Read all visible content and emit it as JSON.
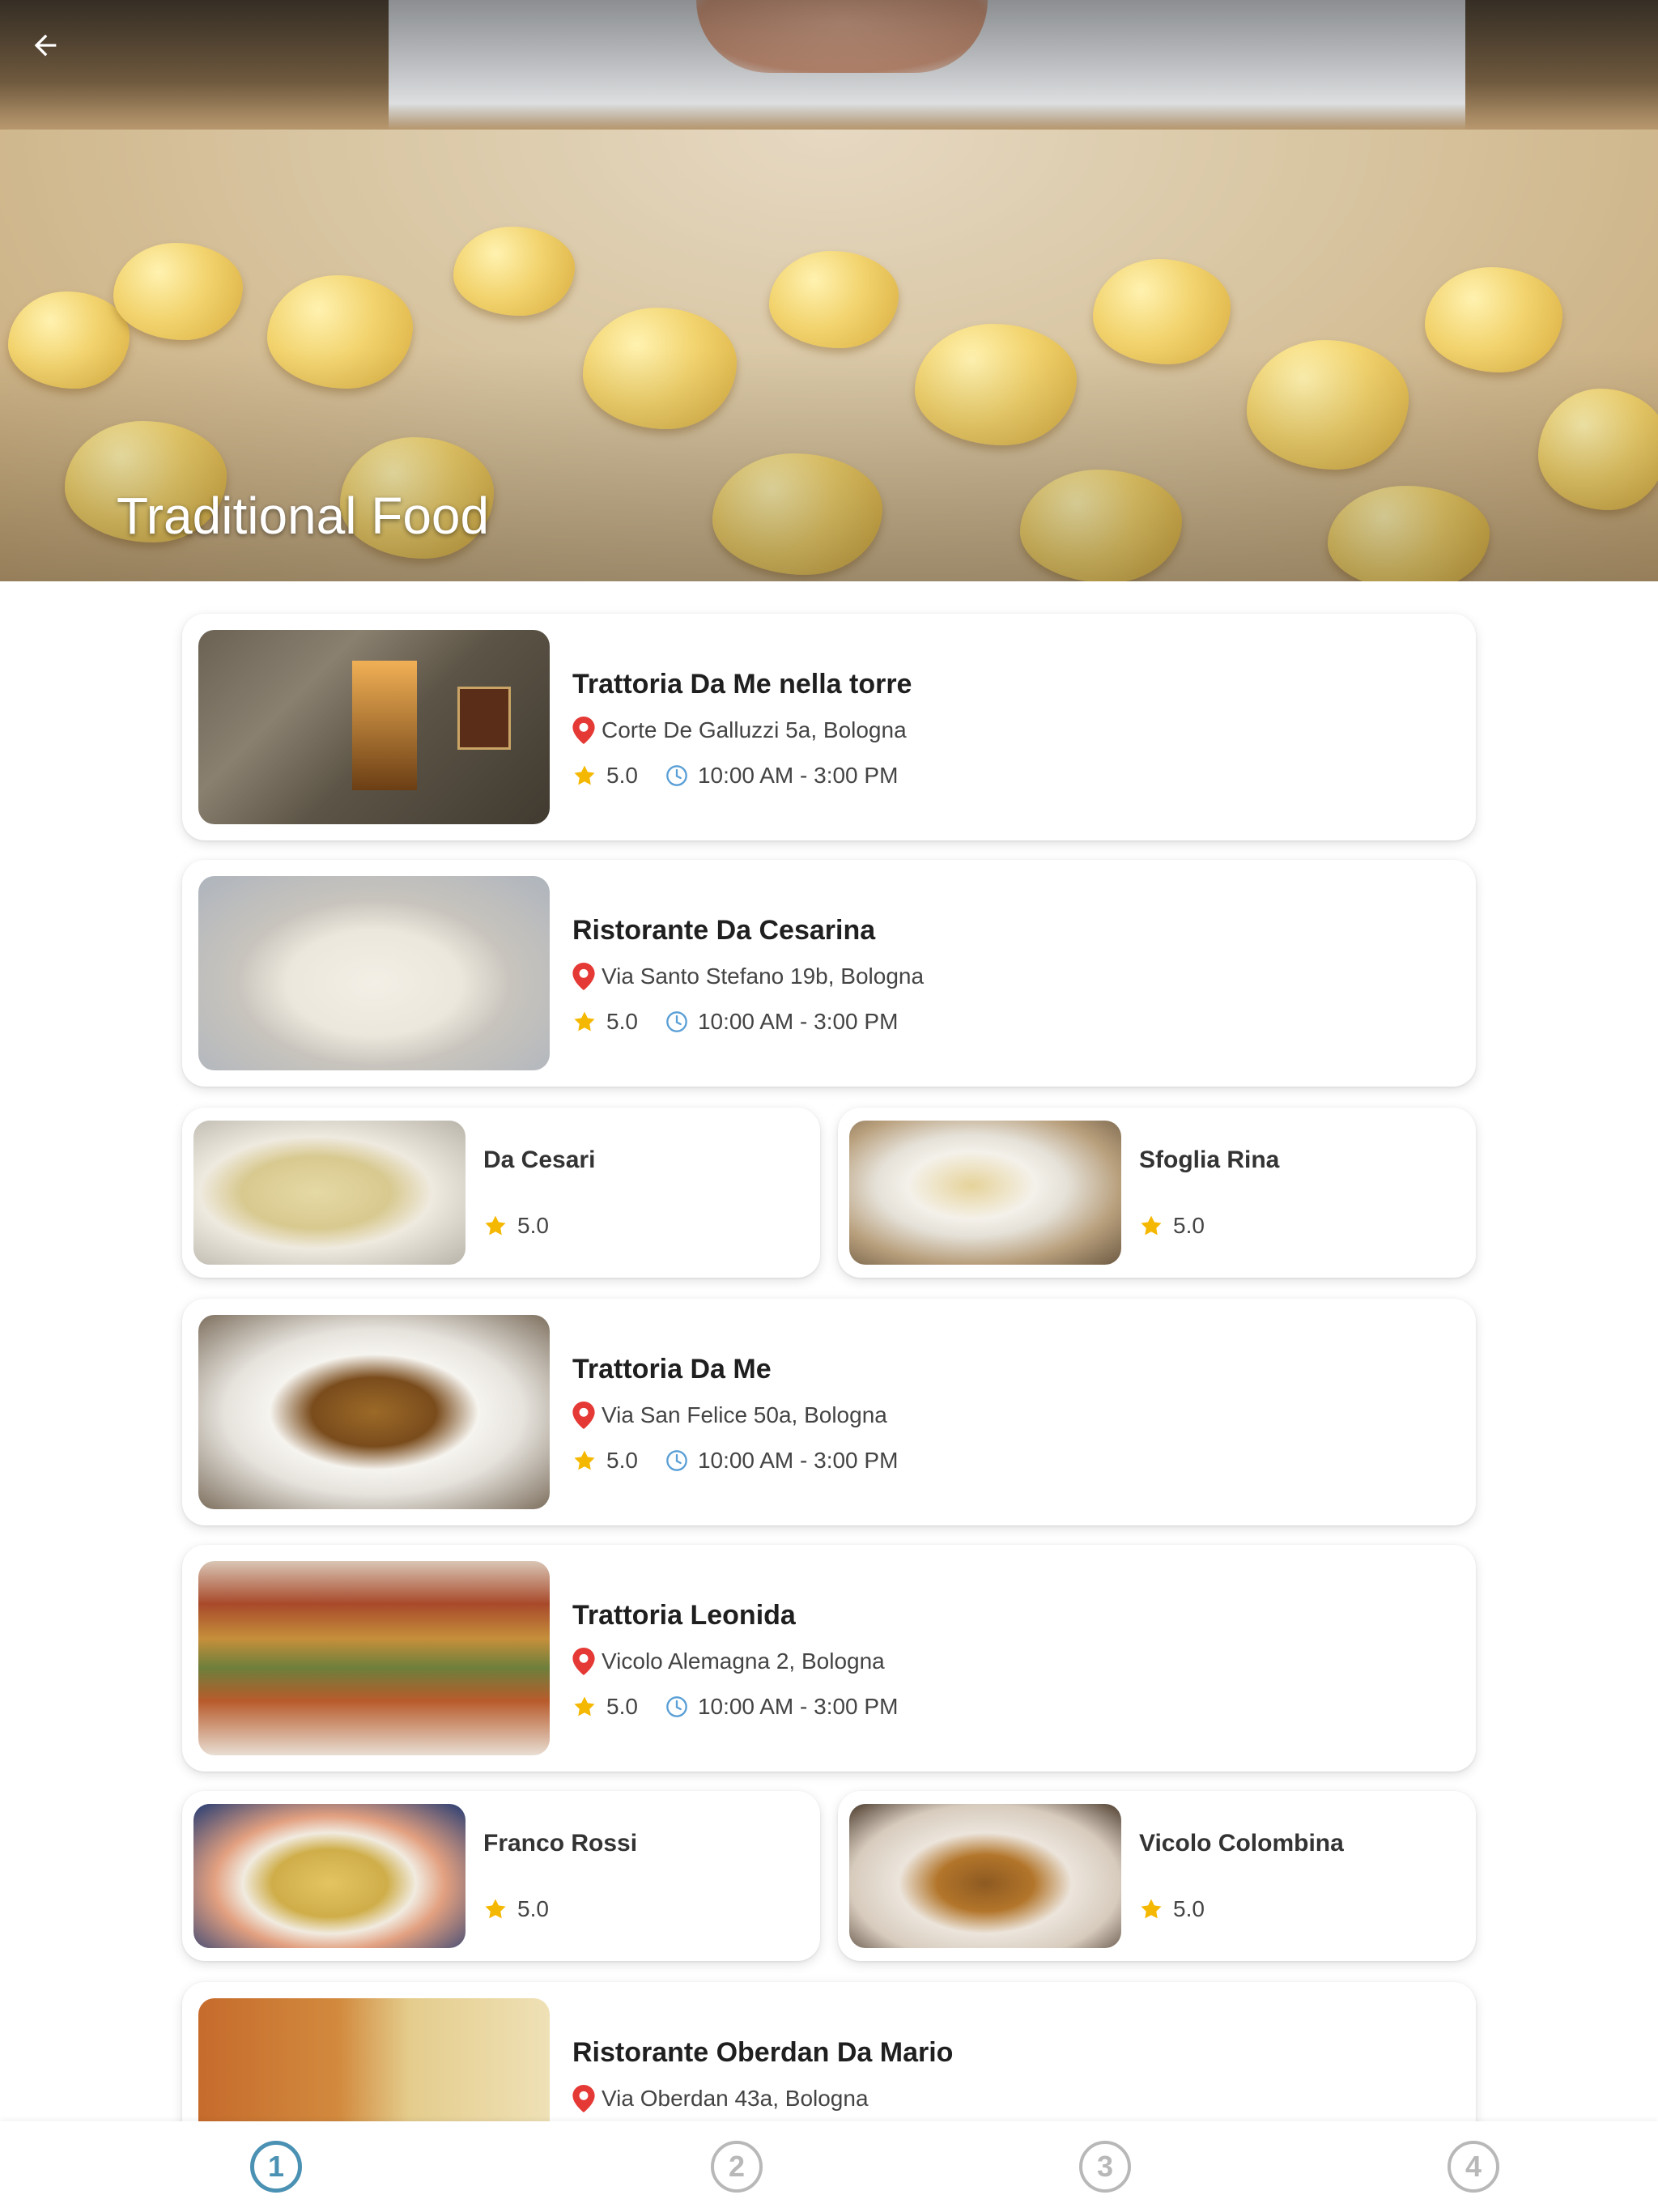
{
  "hero": {
    "title": "Traditional Food"
  },
  "restaurants": [
    {
      "name": "Trattoria Da Me nella torre",
      "address": "Corte De Galluzzi 5a, Bologna",
      "rating": "5.0",
      "hours": "10:00 AM - 3:00 PM"
    },
    {
      "name": "Ristorante Da Cesarina",
      "address": "Via Santo Stefano 19b, Bologna",
      "rating": "5.0",
      "hours": "10:00 AM - 3:00 PM"
    },
    {
      "name": "Da Cesari",
      "rating": "5.0"
    },
    {
      "name": "Sfoglia Rina",
      "rating": "5.0"
    },
    {
      "name": "Trattoria Da Me",
      "address": "Via San Felice 50a, Bologna",
      "rating": "5.0",
      "hours": "10:00 AM - 3:00 PM"
    },
    {
      "name": "Trattoria Leonida",
      "address": "Vicolo Alemagna 2, Bologna",
      "rating": "5.0",
      "hours": "10:00 AM - 3:00 PM"
    },
    {
      "name": "Franco Rossi",
      "rating": "5.0"
    },
    {
      "name": "Vicolo Colombina",
      "rating": "5.0"
    },
    {
      "name": "Ristorante Oberdan Da Mario",
      "address": "Via Oberdan 43a, Bologna"
    }
  ],
  "bottom_nav": {
    "items": [
      {
        "label": "1",
        "active": true
      },
      {
        "label": "2",
        "active": false
      },
      {
        "label": "3",
        "active": false
      },
      {
        "label": "4",
        "active": false
      }
    ]
  },
  "colors": {
    "accent": "#4a91b3",
    "pin": "#e53935",
    "star": "#f5b800",
    "clock": "#5a9fd6",
    "inactive_nav": "#b8b8b8"
  },
  "icons": {
    "back": "arrow-left",
    "pin": "map-pin",
    "rating": "star",
    "hours": "clock"
  }
}
